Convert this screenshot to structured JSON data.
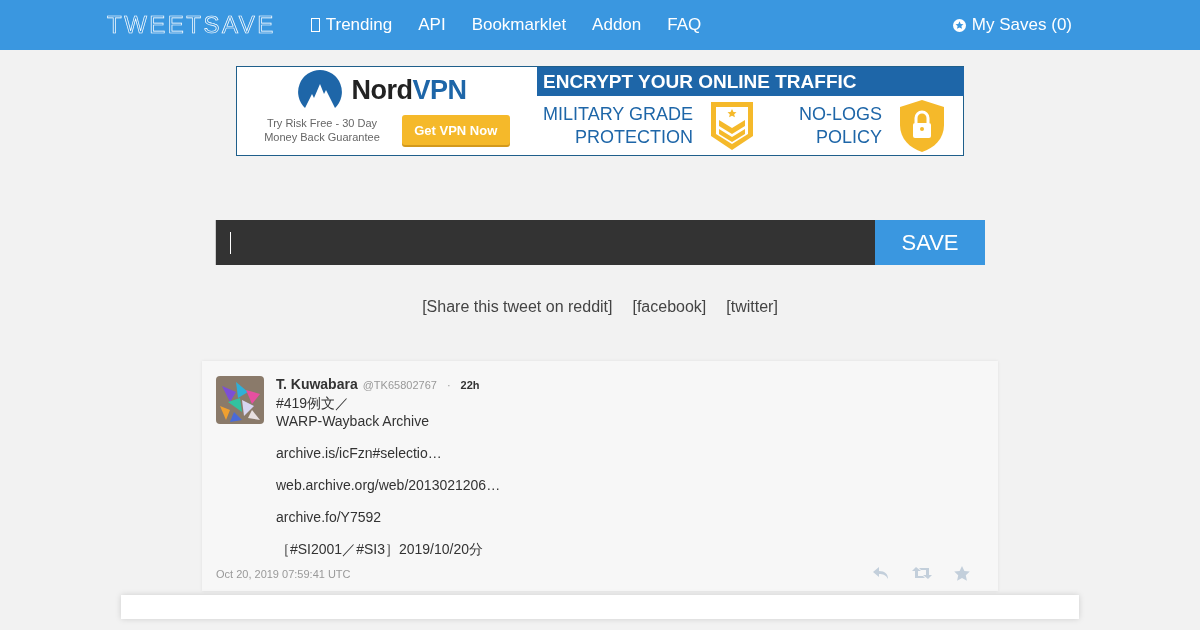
{
  "navbar": {
    "logo": "TWEETSAVE",
    "links": [
      {
        "label": "Trending",
        "kind": "icon_link"
      },
      {
        "label": "API",
        "kind": "text_link"
      },
      {
        "label": "Bookmarklet",
        "kind": "text_link"
      },
      {
        "label": "Addon",
        "kind": "text_link"
      },
      {
        "label": "FAQ",
        "kind": "text_link"
      }
    ],
    "my_saves": "My Saves (0)"
  },
  "ad": {
    "brand_dark": "Nord",
    "brand_accent": "VPN",
    "tagline": [
      "Try Risk Free - 30 Day",
      "Money Back Guarantee"
    ],
    "cta": "Get VPN Now",
    "headline": "ENCRYPT YOUR ONLINE TRAFFIC",
    "features": [
      {
        "kind": "badge",
        "lines": [
          "MILITARY GRADE",
          "PROTECTION"
        ]
      },
      {
        "kind": "lock",
        "lines": [
          "NO-LOGS",
          "POLICY"
        ]
      }
    ]
  },
  "save_form": {
    "button": "SAVE"
  },
  "share_links": [
    "[Share this tweet on reddit]",
    "[facebook]",
    "[twitter]"
  ],
  "tweet": {
    "name": "T. Kuwabara",
    "handle": "@TK65802767",
    "separator": "·",
    "time": "22h",
    "paragraphs": [
      [
        "#419例文／",
        "WARP-Wayback Archive"
      ],
      [
        "archive.is/icFzn#selectio…"
      ],
      [
        "web.archive.org/web/2013021206…"
      ],
      [
        "archive.fo/Y7592"
      ],
      [
        "［#SI2001／#SI3］2019/10/20分"
      ]
    ],
    "timestamp": "Oct 20, 2019 07:59:41 UTC"
  }
}
